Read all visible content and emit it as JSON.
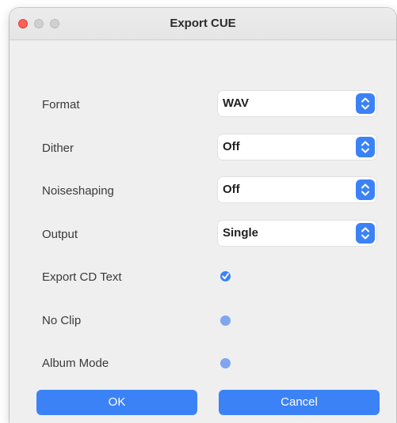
{
  "window": {
    "title": "Export CUE"
  },
  "fields": {
    "format": {
      "label": "Format",
      "value": "WAV"
    },
    "dither": {
      "label": "Dither",
      "value": "Off"
    },
    "noiseshaping": {
      "label": "Noiseshaping",
      "value": "Off"
    },
    "output": {
      "label": "Output",
      "value": "Single"
    }
  },
  "options": {
    "export_cd_text": {
      "label": "Export CD Text",
      "checked": true
    },
    "no_clip": {
      "label": "No Clip",
      "checked": false
    },
    "album_mode": {
      "label": "Album Mode",
      "checked": false
    }
  },
  "buttons": {
    "ok": "OK",
    "cancel": "Cancel"
  },
  "colors": {
    "accent": "#3b82f6",
    "close": "#ff5f57"
  },
  "icons": {
    "select_stepper": "chevron-up-down-icon",
    "checkbox": "checkmark-icon"
  }
}
